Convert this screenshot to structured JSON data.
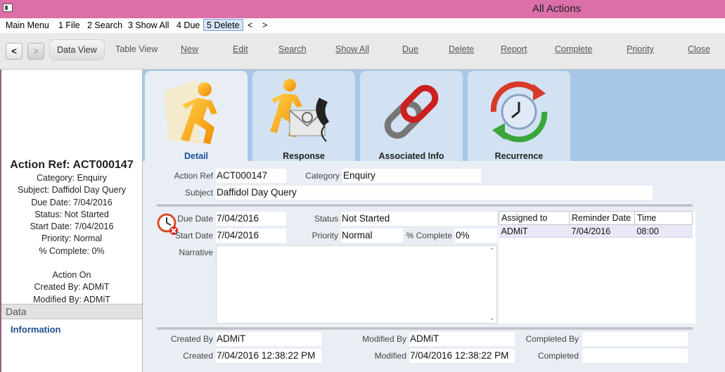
{
  "window": {
    "title": "All Actions"
  },
  "menu": [
    "Main Menu",
    "1 File",
    "2 Search",
    "3 Show All",
    "4 Due",
    "5 Delete",
    "<",
    ">"
  ],
  "toolbar": {
    "back": "<",
    "forward": ">",
    "buttons": [
      "Data View",
      "Table View",
      "New",
      "Edit",
      "Search",
      "Show All",
      "Due",
      "Delete",
      "Report",
      "Complete",
      "Priority",
      "Close"
    ]
  },
  "summary": {
    "action_ref": "Action Ref: ACT000147",
    "lines": [
      "Category: Enquiry",
      "Subject: Daffidol Day Query",
      "Due Date: 7/04/2016",
      "Status: Not Started",
      "Start Date: 7/04/2016",
      "Priority: Normal",
      "% Complete: 0%"
    ],
    "action_on": "Action On",
    "created_by": "Created By: ADMiT",
    "modified_by": "Modified By: ADMiT"
  },
  "sidebar": {
    "section": "Data",
    "item": "Information"
  },
  "tabs": [
    "Detail",
    "Response",
    "Associated Info",
    "Recurrence"
  ],
  "labels": {
    "action_ref": "Action Ref",
    "category": "Category",
    "subject": "Subject",
    "due_date": "Due Date",
    "start_date": "Start Date",
    "status": "Status",
    "priority": "Priority",
    "pct_complete": "% Complete",
    "narrative": "Narrative",
    "created_by": "Created By",
    "created": "Created",
    "modified_by": "Modified By",
    "modified": "Modified",
    "completed_by": "Completed By",
    "completed": "Completed"
  },
  "values": {
    "action_ref": "ACT000147",
    "category": "Enquiry",
    "subject": "Daffidol Day Query",
    "due_date": "7/04/2016",
    "start_date": "7/04/2016",
    "status": "Not Started",
    "priority": "Normal",
    "pct_complete": "0%",
    "narrative": "",
    "created_by": "ADMiT",
    "created": "7/04/2016 12:38:22 PM",
    "modified_by": "ADMiT",
    "modified": "7/04/2016 12:38:22 PM",
    "completed_by": "",
    "completed": ""
  },
  "assigned": {
    "headers": [
      "Assigned to",
      "Reminder Date",
      "Time"
    ],
    "rows": [
      [
        "ADMiT",
        "7/04/2016",
        "08:00"
      ]
    ]
  },
  "colors": {
    "titlebar": "#dc6fa8",
    "tabstrip": "#a8c7e6",
    "accent_link": "#1f4e8c"
  }
}
